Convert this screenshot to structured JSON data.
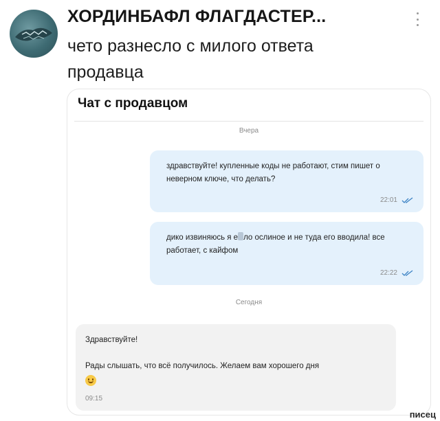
{
  "post": {
    "author": "ХОРДИНБАФЛ ФЛАГДАСТЕР...",
    "text": "чето разнесло с милого ответа продавца",
    "avatar_icon": "avatar-image"
  },
  "chat": {
    "title": "Чат с продавцом",
    "date_yesterday": "Вчера",
    "date_today": "Сегодня",
    "messages": [
      {
        "direction": "outgoing",
        "text": "здравствуйте! купленные коды не работают, стим пишет о неверном ключе, что делать?",
        "time": "22:01",
        "status": "read"
      },
      {
        "direction": "outgoing",
        "text_before": "дико извиняюсь я е",
        "text_after": "ло ослиное и не туда его вводила! все работает, с кайфом",
        "time": "22:22",
        "status": "read"
      },
      {
        "direction": "incoming",
        "line1": "Здравствуйте!",
        "line2": "Рады слышать, что всё получилось. Желаем вам хорошего дня",
        "emoji": "smile-emoji",
        "time": "09:15"
      }
    ]
  },
  "watermark": "писец",
  "colors": {
    "outgoing_bubble": "#e4f1fc",
    "incoming_bubble": "#f2f2f2",
    "read_ticks": "#3b82c4"
  }
}
